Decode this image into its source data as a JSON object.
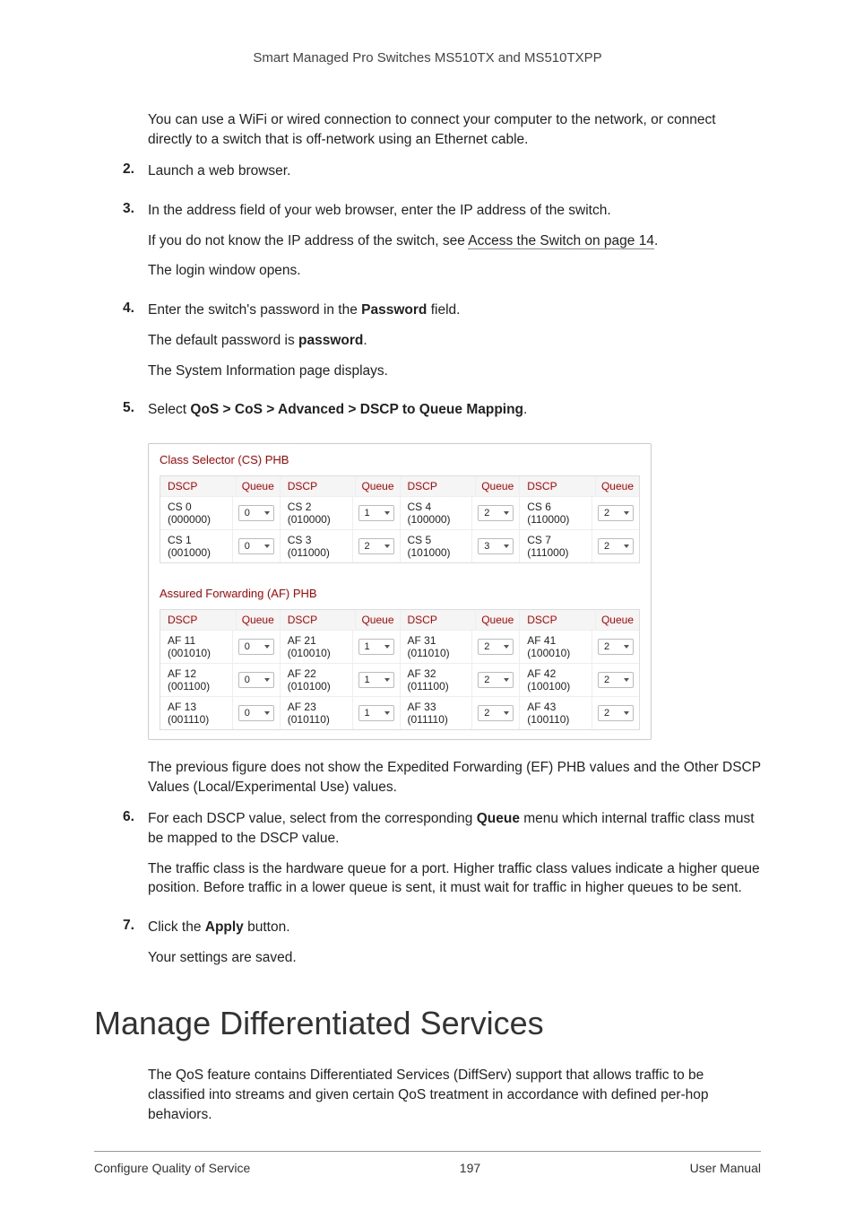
{
  "header": {
    "title": "Smart Managed Pro Switches MS510TX and MS510TXPP"
  },
  "intro": "You can use a WiFi or wired connection to connect your computer to the network, or connect directly to a switch that is off-network using an Ethernet cable.",
  "steps": {
    "s2": {
      "num": "2.",
      "text": "Launch a web browser."
    },
    "s3": {
      "num": "3.",
      "text": "In the address field of your web browser, enter the IP address of the switch.",
      "note_pre": "If you do not know the IP address of the switch, see ",
      "note_link": "Access the Switch on page 14",
      "note_post": ".",
      "note2": "The login window opens."
    },
    "s4": {
      "num": "4.",
      "text_pre": "Enter the switch's password in the ",
      "text_bold": "Password",
      "text_post": " field.",
      "note_pre": "The default password is ",
      "note_bold": "password",
      "note_post": ".",
      "note2": "The System Information page displays."
    },
    "s5": {
      "num": "5.",
      "text_pre": "Select ",
      "text_bold": "QoS > CoS > Advanced > DSCP to Queue Mapping",
      "text_post": "."
    },
    "s6": {
      "num": "6.",
      "text_pre": "For each DSCP value, select from the corresponding ",
      "text_bold": "Queue",
      "text_post": " menu which internal traffic class must be mapped to the DSCP value.",
      "note": "The traffic class is the hardware queue for a port. Higher traffic class values indicate a higher queue position. Before traffic in a lower queue is sent, it must wait for traffic in higher queues to be sent."
    },
    "s7": {
      "num": "7.",
      "text_pre": "Click the ",
      "text_bold": "Apply",
      "text_post": " button.",
      "note": "Your settings are saved."
    }
  },
  "figure_caption": "The previous figure does not show the Expedited Forwarding (EF) PHB values and the Other DSCP Values (Local/Experimental Use) values.",
  "figure": {
    "cs": {
      "title": "Class Selector (CS) PHB",
      "headers": {
        "dscp": "DSCP",
        "queue": "Queue"
      },
      "rows": [
        [
          {
            "d": "CS 0 (000000)",
            "q": "0"
          },
          {
            "d": "CS 2 (010000)",
            "q": "1"
          },
          {
            "d": "CS 4 (100000)",
            "q": "2"
          },
          {
            "d": "CS 6 (110000)",
            "q": "2"
          }
        ],
        [
          {
            "d": "CS 1 (001000)",
            "q": "0"
          },
          {
            "d": "CS 3 (011000)",
            "q": "2"
          },
          {
            "d": "CS 5 (101000)",
            "q": "3"
          },
          {
            "d": "CS 7 (111000)",
            "q": "2"
          }
        ]
      ]
    },
    "af": {
      "title": "Assured Forwarding (AF) PHB",
      "headers": {
        "dscp": "DSCP",
        "queue": "Queue"
      },
      "rows": [
        [
          {
            "d": "AF 11 (001010)",
            "q": "0"
          },
          {
            "d": "AF 21 (010010)",
            "q": "1"
          },
          {
            "d": "AF 31 (011010)",
            "q": "2"
          },
          {
            "d": "AF 41 (100010)",
            "q": "2"
          }
        ],
        [
          {
            "d": "AF 12 (001100)",
            "q": "0"
          },
          {
            "d": "AF 22 (010100)",
            "q": "1"
          },
          {
            "d": "AF 32 (011100)",
            "q": "2"
          },
          {
            "d": "AF 42 (100100)",
            "q": "2"
          }
        ],
        [
          {
            "d": "AF 13 (001110)",
            "q": "0"
          },
          {
            "d": "AF 23 (010110)",
            "q": "1"
          },
          {
            "d": "AF 33 (011110)",
            "q": "2"
          },
          {
            "d": "AF 43 (100110)",
            "q": "2"
          }
        ]
      ]
    }
  },
  "section_heading": "Manage Differentiated Services",
  "section_body": "The QoS feature contains Differentiated Services (DiffServ) support that allows traffic to be classified into streams and given certain QoS treatment in accordance with defined per-hop behaviors.",
  "footer": {
    "left": "Configure Quality of Service",
    "center": "197",
    "right": "User Manual"
  }
}
